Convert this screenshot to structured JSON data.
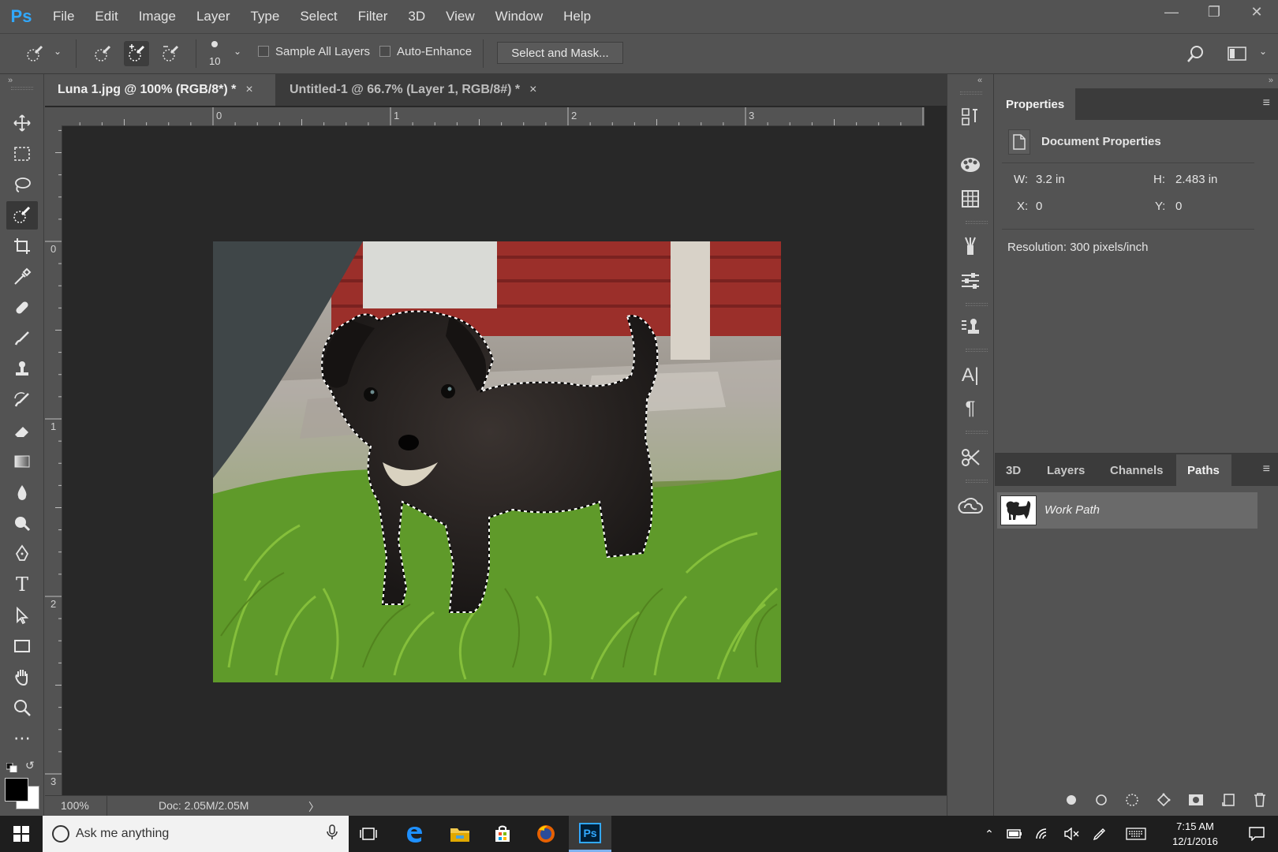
{
  "app": {
    "logo": "Ps",
    "menu": [
      "File",
      "Edit",
      "Image",
      "Layer",
      "Type",
      "Select",
      "Filter",
      "3D",
      "View",
      "Window",
      "Help"
    ],
    "window_controls": [
      "minimize-icon",
      "restore-icon",
      "close-icon"
    ]
  },
  "options_bar": {
    "brush_size": "10",
    "sample_all_layers_label": "Sample All Layers",
    "sample_all_layers_checked": false,
    "auto_enhance_label": "Auto-Enhance",
    "auto_enhance_checked": false,
    "select_and_mask_label": "Select and Mask..."
  },
  "tools": [
    "move-icon",
    "marquee-icon",
    "lasso-icon",
    "quick-selection-icon",
    "crop-icon",
    "eyedropper-icon",
    "healing-brush-icon",
    "brush-icon",
    "clone-stamp-icon",
    "history-brush-icon",
    "eraser-icon",
    "gradient-icon",
    "blur-icon",
    "dodge-icon",
    "pen-icon",
    "type-icon",
    "path-selection-icon",
    "rectangle-icon",
    "hand-icon",
    "zoom-icon",
    "more-tools-icon"
  ],
  "selected_tool": "quick-selection-icon",
  "documents": {
    "tabs": [
      {
        "label": "Luna 1.jpg @ 100% (RGB/8*) *",
        "active": true
      },
      {
        "label": "Untitled-1 @ 66.7% (Layer 1, RGB/8#) *",
        "active": false
      }
    ],
    "close_glyph": "×"
  },
  "rulers": {
    "horizontal": [
      "0",
      "1",
      "2",
      "3"
    ],
    "vertical": [
      "0",
      "1",
      "2",
      "3"
    ]
  },
  "status": {
    "zoom": "100%",
    "doc_size": "Doc: 2.05M/2.05M",
    "arrow": "〉"
  },
  "properties": {
    "tab_label": "Properties",
    "section_title": "Document Properties",
    "w_label": "W:",
    "w_value": "3.2 in",
    "h_label": "H:",
    "h_value": "2.483 in",
    "x_label": "X:",
    "x_value": "0",
    "y_label": "Y:",
    "y_value": "0",
    "resolution": "Resolution: 300 pixels/inch"
  },
  "paths_panel": {
    "tabs": [
      "3D",
      "Layers",
      "Channels",
      "Paths"
    ],
    "active_tab": "Paths",
    "items": [
      {
        "name": "Work Path"
      }
    ]
  },
  "taskbar": {
    "search_placeholder": "Ask me anything",
    "time": "7:15 AM",
    "date": "12/1/2016"
  },
  "colors": {
    "accent": "#31a8ff",
    "panel_bg": "#535353",
    "canvas_bg": "#282828"
  }
}
